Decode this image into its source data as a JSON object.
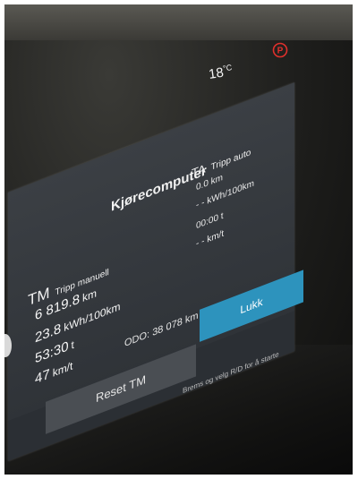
{
  "status_bar": {
    "temperature": "18",
    "temperature_unit": "°C",
    "parking_icon": "parking-brake-icon",
    "parking_color": "#e0302c"
  },
  "dialog": {
    "title": "Kjørecomputer",
    "trip_manual": {
      "code": "TM",
      "label": "Tripp manuell",
      "distance": "6 819.8",
      "distance_unit": "km",
      "consumption": "23.8",
      "consumption_unit": "kWh/100km",
      "time": "53:30",
      "time_unit": "t",
      "speed": "47",
      "speed_unit": "km/t"
    },
    "trip_auto": {
      "code": "TA",
      "label": "Tripp auto",
      "distance": "0.0 km",
      "consumption": "- - kWh/100km",
      "time": "00:00 t",
      "speed": "- - km/t"
    },
    "odo_label": "ODO:",
    "odo_value": "38 078",
    "odo_unit": "km",
    "close_button": "Lukk",
    "reset_button": "Reset TM",
    "hint": "Brems og velg R/D for å starte",
    "accent_color": "#2d93bd"
  }
}
